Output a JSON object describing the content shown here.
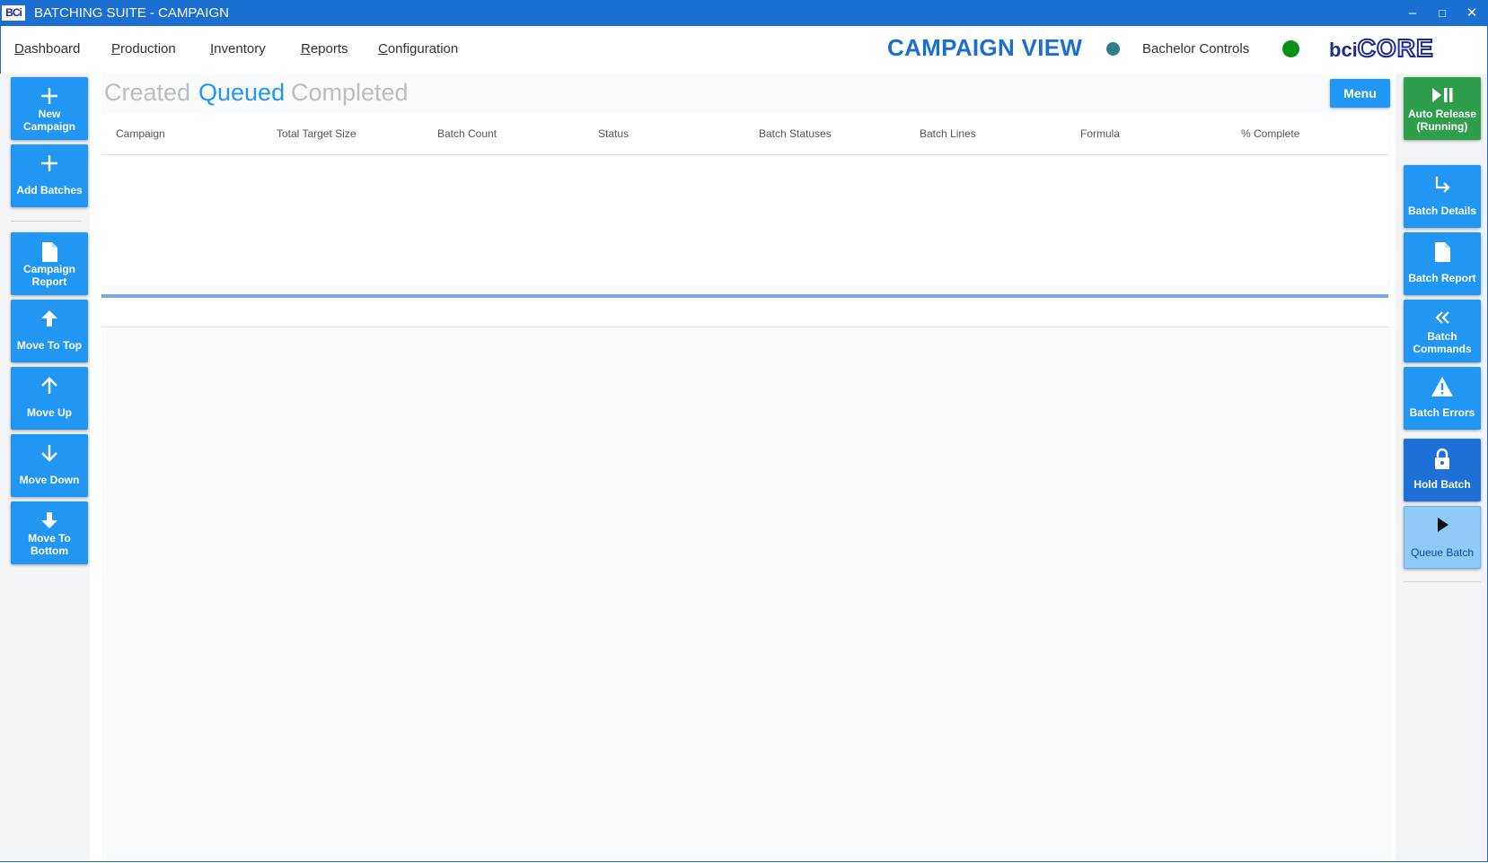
{
  "window": {
    "logo": "BCi",
    "title": "BATCHING SUITE - CAMPAIGN",
    "minimize": "–",
    "maximize": "□",
    "close": "✕"
  },
  "menu": [
    {
      "first": "D",
      "rest": "ashboard"
    },
    {
      "first": "P",
      "rest": "roduction"
    },
    {
      "first": "I",
      "rest": "nventory"
    },
    {
      "first": "R",
      "rest": "eports"
    },
    {
      "first": "C",
      "rest": "onfiguration"
    }
  ],
  "header": {
    "view_title": "CAMPAIGN VIEW",
    "company": "Bachelor Controls",
    "brand_prefix": "bci",
    "brand_name": "CORE",
    "status_colors": {
      "connection": "#2f7f8a",
      "online": "#0a8f1a"
    }
  },
  "left_actions": [
    {
      "label": "New Campaign",
      "icon": "plus-icon"
    },
    {
      "label": "Add Batches",
      "icon": "plus-icon"
    },
    {
      "label": "Campaign Report",
      "icon": "document-icon"
    },
    {
      "label": "Move To Top",
      "icon": "arrow-up-bold-icon"
    },
    {
      "label": "Move Up",
      "icon": "arrow-up-icon"
    },
    {
      "label": "Move Down",
      "icon": "arrow-down-icon"
    },
    {
      "label": "Move To Bottom",
      "icon": "arrow-down-bold-icon"
    }
  ],
  "tabs": {
    "created": "Created",
    "queued": "Queued",
    "completed": "Completed",
    "active": "Queued"
  },
  "menu_button": "Menu",
  "table": {
    "columns": [
      "Campaign",
      "Total Target Size",
      "Batch Count",
      "Status",
      "Batch Statuses",
      "Batch Lines",
      "Formula",
      "% Complete"
    ],
    "rows": []
  },
  "right_actions": [
    {
      "label": "Auto Release (Running)",
      "icon": "play-pause-icon"
    },
    {
      "label": "Batch Details",
      "icon": "return-arrow-icon"
    },
    {
      "label": "Batch Report",
      "icon": "document-icon"
    },
    {
      "label": "Batch Commands",
      "icon": "double-chevron-left-icon"
    },
    {
      "label": "Batch Errors",
      "icon": "warning-icon"
    },
    {
      "label": "Hold Batch",
      "icon": "lock-icon"
    },
    {
      "label": "Queue Batch",
      "icon": "play-icon"
    }
  ]
}
